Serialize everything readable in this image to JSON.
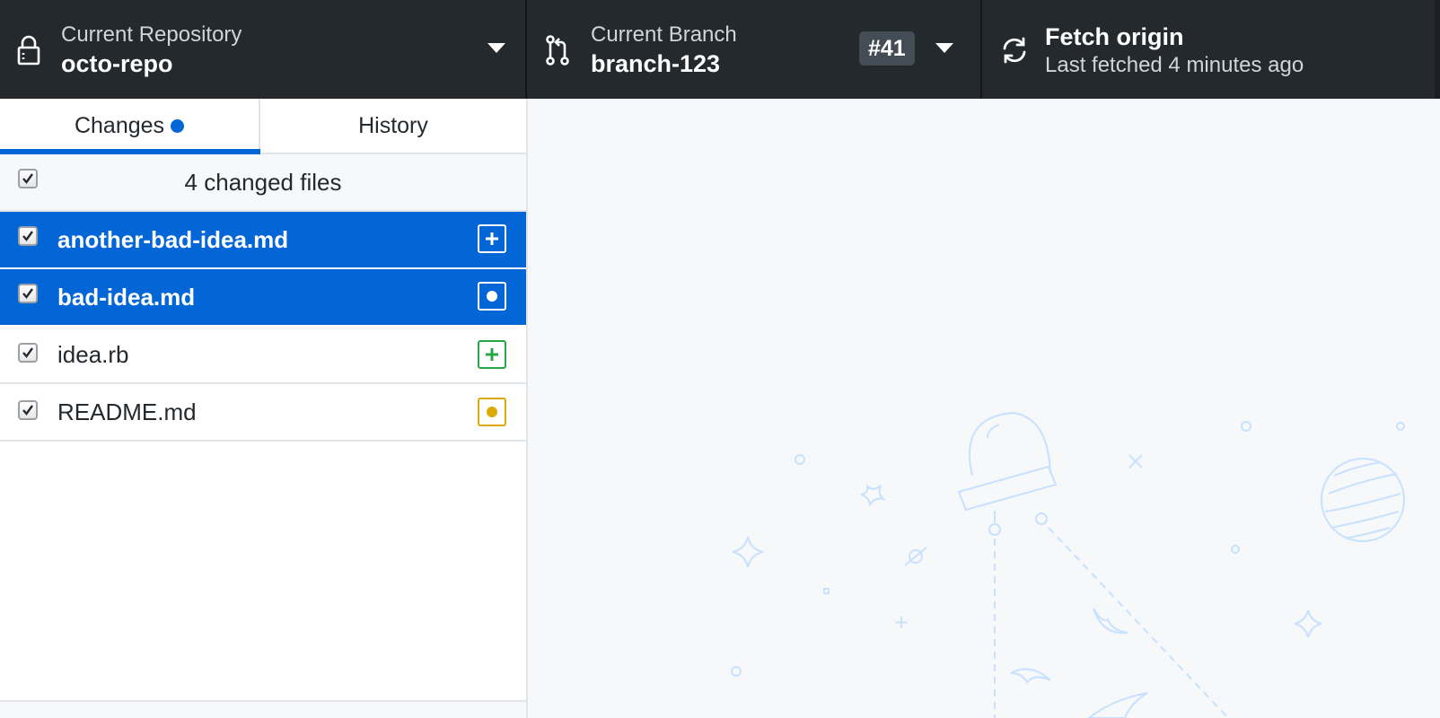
{
  "toolbar": {
    "repository": {
      "label": "Current Repository",
      "value": "octo-repo",
      "icon": "lock-icon"
    },
    "branch": {
      "label": "Current Branch",
      "value": "branch-123",
      "pr_badge": "#41",
      "icon": "git-pull-request-icon"
    },
    "fetch": {
      "label": "Fetch origin",
      "status": "Last fetched 4 minutes ago",
      "icon": "sync-icon"
    }
  },
  "sidebar": {
    "tabs": [
      {
        "label": "Changes",
        "active": true,
        "has_indicator": true
      },
      {
        "label": "History",
        "active": false
      }
    ],
    "header": {
      "label": "4 changed files",
      "all_checked": true
    },
    "files": [
      {
        "name": "another-bad-idea.md",
        "status": "added",
        "selected": true,
        "checked": true
      },
      {
        "name": "bad-idea.md",
        "status": "modified",
        "selected": true,
        "checked": true
      },
      {
        "name": "idea.rb",
        "status": "added",
        "selected": false,
        "checked": true
      },
      {
        "name": "README.md",
        "status": "modified",
        "selected": false,
        "checked": true
      }
    ]
  },
  "colors": {
    "toolbar_bg": "#24292e",
    "accent_blue": "#0366d6",
    "added_green": "#28a745",
    "modified_yellow": "#dbab09",
    "illustration": "#c8e1ff"
  }
}
